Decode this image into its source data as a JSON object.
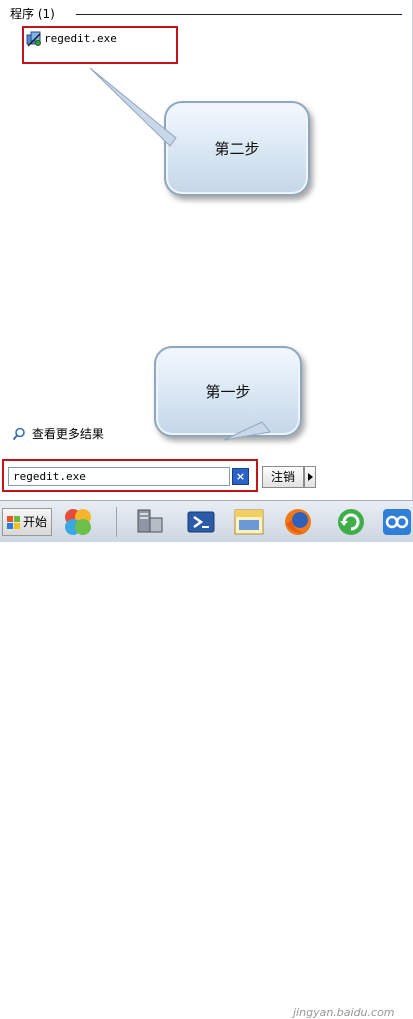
{
  "start_menu": {
    "programs_header": "程序 (1)",
    "result": {
      "label": "regedit.exe",
      "icon": "regedit-icon"
    },
    "more_results": "查看更多结果",
    "search": {
      "value": "regedit.exe"
    },
    "clear_glyph": "×",
    "logoff_label": "注销"
  },
  "callouts": {
    "step2": "第二步",
    "step1": "第一步"
  },
  "taskbar": {
    "start_label": "开始",
    "icons": [
      "app-ball-icon",
      "server-manager-icon",
      "powershell-icon",
      "file-explorer-icon",
      "firefox-icon",
      "refresh-icon",
      "app-icon"
    ]
  },
  "watermark": "jingyan.baidu.com",
  "colors": {
    "highlight": "#c0141e",
    "callout_fill": "#d8e6f3"
  }
}
